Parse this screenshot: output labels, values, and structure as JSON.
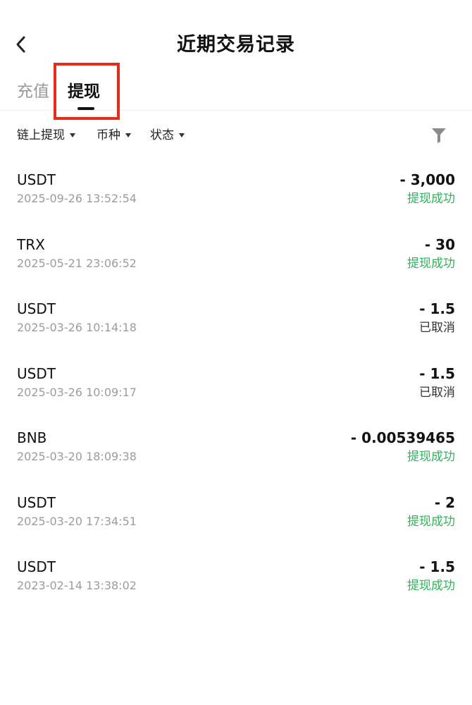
{
  "header": {
    "title": "近期交易记录",
    "back_icon": "chevron-left-icon"
  },
  "tabs": [
    {
      "label": "充值",
      "active": false
    },
    {
      "label": "提现",
      "active": true
    }
  ],
  "annotation": {
    "highlight_color": "#e62b1a"
  },
  "filters": {
    "chain_label": "链上提现",
    "coin_label": "币种",
    "status_label": "状态",
    "filter_icon": "funnel-icon"
  },
  "colors": {
    "success": "#2fb35a",
    "cancelled": "#333333",
    "muted": "#9c9c9c"
  },
  "records": [
    {
      "coin": "USDT",
      "time": "2025-09-26 13:52:54",
      "amount": "- 3,000",
      "status": "提现成功",
      "status_type": "success"
    },
    {
      "coin": "TRX",
      "time": "2025-05-21 23:06:52",
      "amount": "- 30",
      "status": "提现成功",
      "status_type": "success"
    },
    {
      "coin": "USDT",
      "time": "2025-03-26 10:14:18",
      "amount": "- 1.5",
      "status": "已取消",
      "status_type": "cancelled"
    },
    {
      "coin": "USDT",
      "time": "2025-03-26 10:09:17",
      "amount": "- 1.5",
      "status": "已取消",
      "status_type": "cancelled"
    },
    {
      "coin": "BNB",
      "time": "2025-03-20 18:09:38",
      "amount": "- 0.00539465",
      "status": "提现成功",
      "status_type": "success"
    },
    {
      "coin": "USDT",
      "time": "2025-03-20 17:34:51",
      "amount": "- 2",
      "status": "提现成功",
      "status_type": "success"
    },
    {
      "coin": "USDT",
      "time": "2023-02-14 13:38:02",
      "amount": "- 1.5",
      "status": "提现成功",
      "status_type": "success"
    }
  ]
}
